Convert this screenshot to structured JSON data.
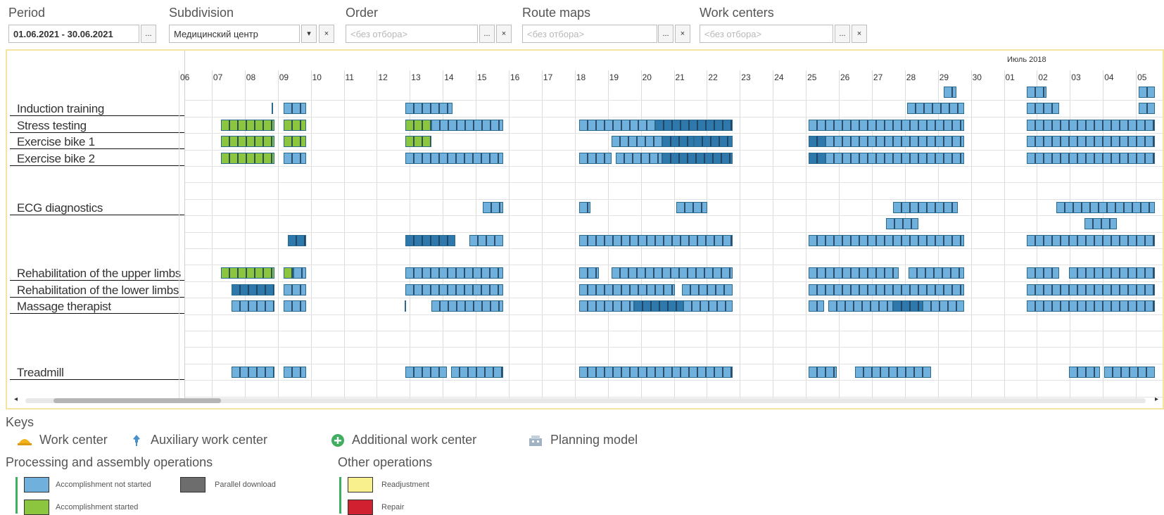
{
  "filters": {
    "period": {
      "label": "Period",
      "value": "01.06.2021 - 30.06.2021",
      "btn": "..."
    },
    "subdivision": {
      "label": "Subdivision",
      "value": "Медицинский центр",
      "drop": "▾",
      "clear": "×"
    },
    "order": {
      "label": "Order",
      "placeholder": "<без отбора>",
      "btn": "...",
      "clear": "×"
    },
    "route_maps": {
      "label": "Route maps",
      "placeholder": "<без отбора>",
      "btn": "...",
      "clear": "×"
    },
    "work_centers": {
      "label": "Work centers",
      "placeholder": "<без отбора>",
      "btn": "...",
      "clear": "×"
    }
  },
  "gantt": {
    "month_label": "Июль 2018",
    "days": [
      "06",
      "07",
      "08",
      "09",
      "10",
      "11",
      "12",
      "13",
      "14",
      "15",
      "16",
      "17",
      "18",
      "19",
      "20",
      "21",
      "22",
      "23",
      "24",
      "25",
      "26",
      "27",
      "28",
      "29",
      "30",
      "01",
      "02",
      "03",
      "04",
      "05"
    ],
    "rows": [
      {
        "name": "",
        "bars": [
          [
            1340,
            1358,
            "#6fb1dc"
          ],
          [
            1458,
            1486,
            "#6fb1dc"
          ],
          [
            1617,
            1640,
            "#6fb1dc"
          ]
        ]
      },
      {
        "name": "Induction training",
        "bars": [
          [
            385,
            387,
            "#2a5f88"
          ],
          [
            402,
            434,
            "#6fb1dc"
          ],
          [
            575,
            642,
            "#6fb1dc"
          ],
          [
            1288,
            1369,
            "#6fb1dc"
          ],
          [
            1458,
            1504,
            "#6fb1dc"
          ],
          [
            1617,
            1640,
            "#6fb1dc"
          ]
        ]
      },
      {
        "name": "Stress testing",
        "bars": [
          [
            313,
            389,
            "#8cc63f"
          ],
          [
            402,
            434,
            "#8cc63f"
          ],
          [
            575,
            612,
            "#8cc63f"
          ],
          [
            612,
            714,
            "#6fb1dc"
          ],
          [
            822,
            930,
            "#6fb1dc"
          ],
          [
            930,
            1040,
            "#2e78ab"
          ],
          [
            1148,
            1369,
            "#6fb1dc"
          ],
          [
            1458,
            1640,
            "#6fb1dc"
          ]
        ]
      },
      {
        "name": "Exercise bike 1",
        "bars": [
          [
            313,
            389,
            "#8cc63f"
          ],
          [
            402,
            434,
            "#8cc63f"
          ],
          [
            575,
            612,
            "#8cc63f"
          ],
          [
            868,
            940,
            "#6fb1dc"
          ],
          [
            940,
            985,
            "#2e78ab"
          ],
          [
            985,
            1040,
            "#2e78ab"
          ],
          [
            1148,
            1172,
            "#2e78ab"
          ],
          [
            1172,
            1369,
            "#6fb1dc"
          ],
          [
            1458,
            1640,
            "#6fb1dc"
          ]
        ]
      },
      {
        "name": "Exercise bike 2",
        "bars": [
          [
            313,
            389,
            "#8cc63f"
          ],
          [
            402,
            434,
            "#6fb1dc"
          ],
          [
            575,
            714,
            "#6fb1dc"
          ],
          [
            822,
            868,
            "#6fb1dc"
          ],
          [
            874,
            940,
            "#6fb1dc"
          ],
          [
            940,
            1040,
            "#2e78ab"
          ],
          [
            1148,
            1172,
            "#2e78ab"
          ],
          [
            1172,
            1369,
            "#6fb1dc"
          ],
          [
            1458,
            1640,
            "#6fb1dc"
          ]
        ]
      },
      {
        "name": "",
        "bars": []
      },
      {
        "name": "",
        "bars": []
      },
      {
        "name": "ECG diagnostics",
        "bars": [
          [
            685,
            714,
            "#6fb1dc"
          ],
          [
            822,
            838,
            "#6fb1dc"
          ],
          [
            960,
            1004,
            "#6fb1dc"
          ],
          [
            1268,
            1360,
            "#6fb1dc"
          ],
          [
            1500,
            1640,
            "#6fb1dc"
          ]
        ]
      },
      {
        "name": "",
        "bars": [
          [
            1258,
            1304,
            "#6fb1dc"
          ],
          [
            1540,
            1586,
            "#6fb1dc"
          ]
        ]
      },
      {
        "name": "",
        "bars": [
          [
            408,
            434,
            "#2e78ab"
          ],
          [
            575,
            646,
            "#2e78ab"
          ],
          [
            666,
            714,
            "#6fb1dc"
          ],
          [
            822,
            1040,
            "#6fb1dc"
          ],
          [
            1148,
            1369,
            "#6fb1dc"
          ],
          [
            1458,
            1640,
            "#6fb1dc"
          ]
        ]
      },
      {
        "name": "",
        "bars": []
      },
      {
        "name": "Rehabilitation of the upper limbs",
        "bars": [
          [
            313,
            389,
            "#8cc63f"
          ],
          [
            402,
            416,
            "#8cc63f"
          ],
          [
            416,
            434,
            "#6fb1dc"
          ],
          [
            575,
            714,
            "#6fb1dc"
          ],
          [
            822,
            850,
            "#6fb1dc"
          ],
          [
            868,
            1040,
            "#6fb1dc"
          ],
          [
            1148,
            1276,
            "#6fb1dc"
          ],
          [
            1290,
            1369,
            "#6fb1dc"
          ],
          [
            1458,
            1504,
            "#6fb1dc"
          ],
          [
            1518,
            1640,
            "#6fb1dc"
          ]
        ]
      },
      {
        "name": "Rehabilitation of the lower limbs",
        "bars": [
          [
            328,
            389,
            "#2e78ab"
          ],
          [
            402,
            434,
            "#6fb1dc"
          ],
          [
            575,
            714,
            "#6fb1dc"
          ],
          [
            822,
            958,
            "#6fb1dc"
          ],
          [
            968,
            1040,
            "#6fb1dc"
          ],
          [
            1148,
            1369,
            "#6fb1dc"
          ],
          [
            1458,
            1640,
            "#6fb1dc"
          ]
        ]
      },
      {
        "name": "Massage therapist",
        "bars": [
          [
            328,
            389,
            "#6fb1dc"
          ],
          [
            402,
            434,
            "#6fb1dc"
          ],
          [
            574,
            576,
            "#2a5f88"
          ],
          [
            612,
            714,
            "#6fb1dc"
          ],
          [
            822,
            900,
            "#6fb1dc"
          ],
          [
            900,
            970,
            "#2e78ab"
          ],
          [
            970,
            1040,
            "#6fb1dc"
          ],
          [
            1148,
            1170,
            "#6fb1dc"
          ],
          [
            1176,
            1268,
            "#6fb1dc"
          ],
          [
            1268,
            1310,
            "#2e78ab"
          ],
          [
            1310,
            1369,
            "#6fb1dc"
          ],
          [
            1458,
            1640,
            "#6fb1dc"
          ]
        ]
      },
      {
        "name": "",
        "bars": []
      },
      {
        "name": "",
        "bars": []
      },
      {
        "name": "",
        "bars": []
      },
      {
        "name": "Treadmill",
        "bars": [
          [
            328,
            389,
            "#6fb1dc"
          ],
          [
            402,
            434,
            "#6fb1dc"
          ],
          [
            575,
            634,
            "#6fb1dc"
          ],
          [
            640,
            714,
            "#6fb1dc"
          ],
          [
            822,
            1040,
            "#6fb1dc"
          ],
          [
            1148,
            1188,
            "#6fb1dc"
          ],
          [
            1214,
            1322,
            "#6fb1dc"
          ],
          [
            1518,
            1562,
            "#6fb1dc"
          ],
          [
            1568,
            1640,
            "#6fb1dc"
          ]
        ]
      },
      {
        "name": "",
        "bars": []
      }
    ]
  },
  "keys": {
    "title": "Keys",
    "items": [
      {
        "label": "Work center",
        "icon": "hard-hat-icon"
      },
      {
        "label": "Auxiliary work center",
        "icon": "pin-icon"
      },
      {
        "label": "Additional work center",
        "icon": "plus-circle-icon"
      },
      {
        "label": "Planning model",
        "icon": "planning-model-icon"
      }
    ],
    "processing_title": "Processing and assembly operations",
    "other_title": "Other operations",
    "processing": [
      {
        "label": "Accomplishment not started",
        "color": "#6fb1dc"
      },
      {
        "label": "Parallel download",
        "color": "#6d6d6d"
      },
      {
        "label": "Accomplishment started",
        "color": "#8cc63f"
      }
    ],
    "other": [
      {
        "label": "Readjustment",
        "color": "#f7f08c"
      },
      {
        "label": "Repair",
        "color": "#d1202f"
      }
    ]
  }
}
